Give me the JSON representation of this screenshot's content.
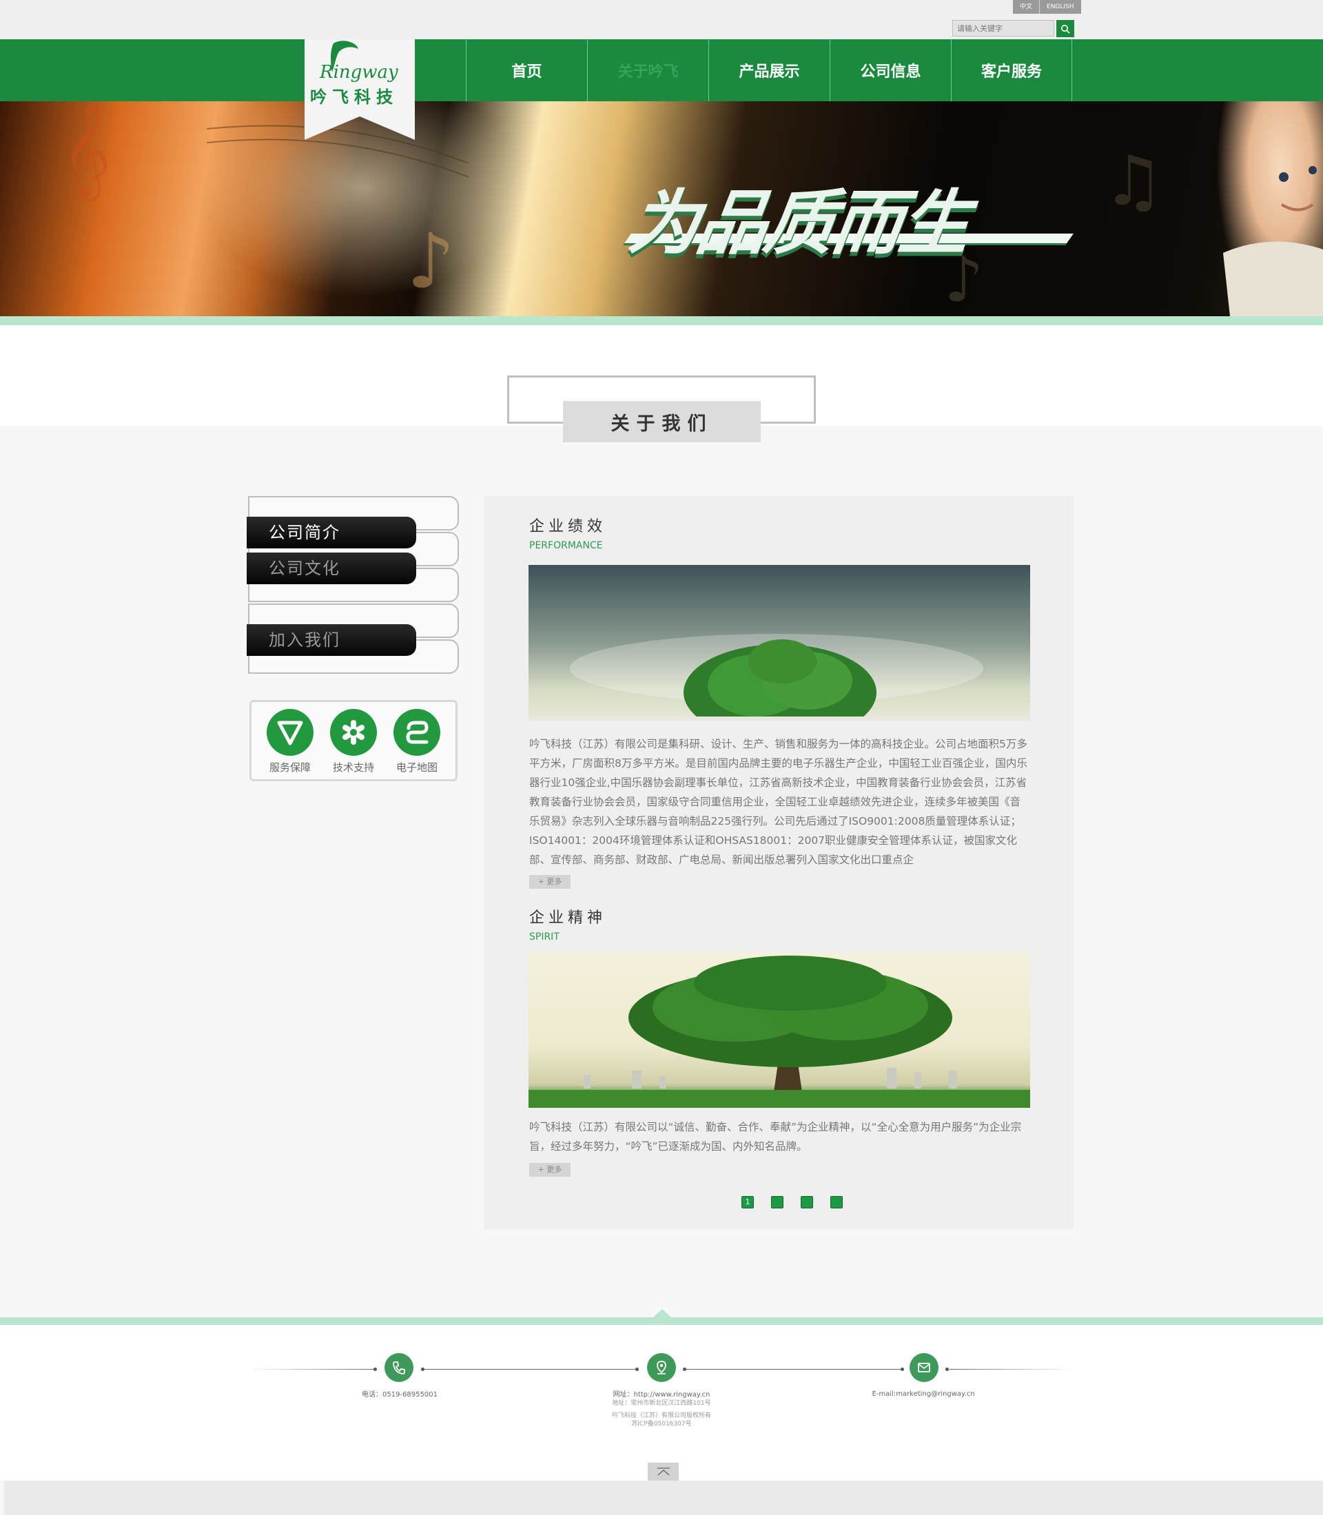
{
  "colors": {
    "brand_green": "#1a8a3e",
    "light_green": "#b8e7cd",
    "panel_gray": "#efefef"
  },
  "header": {
    "lang": [
      "中文",
      "ENGLISH"
    ],
    "search_placeholder": "请输入关键字",
    "logo": {
      "script": "Ringway",
      "name": "吟飞科技"
    }
  },
  "nav": [
    {
      "label": "首页",
      "active": false
    },
    {
      "label": "关于吟飞",
      "active": true
    },
    {
      "label": "产品展示",
      "active": false
    },
    {
      "label": "公司信息",
      "active": false
    },
    {
      "label": "客户服务",
      "active": false
    }
  ],
  "banner": {
    "slogan": "为品质而生"
  },
  "section_title": "关于我们",
  "sidebar": {
    "items": [
      "公司简介",
      "公司文化",
      "",
      "加入我们",
      ""
    ],
    "services": [
      {
        "label": "服务保障",
        "icon": "v-check-icon"
      },
      {
        "label": "技术支持",
        "icon": "gear-star-icon"
      },
      {
        "label": "电子地图",
        "icon": "route-icon"
      }
    ]
  },
  "main": {
    "sections": [
      {
        "title": "企业绩效",
        "subtitle": "PERFORMANCE",
        "image": "tree-sky-photo",
        "text": "吟飞科技（江苏）有限公司是集科研、设计、生产、销售和服务为一体的高科技企业。公司占地面积5万多平方米，厂房面积8万多平方米。是目前国内品牌主要的电子乐器生产企业，中国轻工业百强企业，国内乐器行业10强企业,中国乐器协会副理事长单位，江苏省高新技术企业，中国教育装备行业协会会员，江苏省教育装备行业协会会员，国家级守合同重信用企业，全国轻工业卓越绩效先进企业，连续多年被美国《音乐贸易》杂志列入全球乐器与音响制品225强行列。公司先后通过了ISO9001:2008质量管理体系认证；ISO14001：2004环境管理体系认证和OHSAS18001：2007职业健康安全管理体系认证，被国家文化部、宣传部、商务部、财政部、广电总局、新闻出版总署列入国家文化出口重点企",
        "more": "+ 更多"
      },
      {
        "title": "企业精神",
        "subtitle": "SPIRIT",
        "image": "big-tree-city-photo",
        "text": "吟飞科技（江苏）有限公司以“诚信、勤奋、合作、奉献”为企业精神，以“全心全意为用户服务”为企业宗旨，经过多年努力，“吟飞”已逐渐成为国、内外知名品牌。",
        "more": "+ 更多"
      }
    ],
    "pager": [
      "1",
      "",
      "",
      ""
    ]
  },
  "footer": {
    "phone": "电话：0519-68955001",
    "website": "网址：http://www.ringway.cn",
    "address": "地址：常州市新北区汉江西路101号",
    "copyright": "吟飞科技（江苏）有限公司版权所有",
    "icp": "苏ICP备05016307号",
    "email": "E-mail:marketing@ringway.cn",
    "icons": [
      "phone-icon",
      "location-pin-icon",
      "mail-icon"
    ]
  }
}
